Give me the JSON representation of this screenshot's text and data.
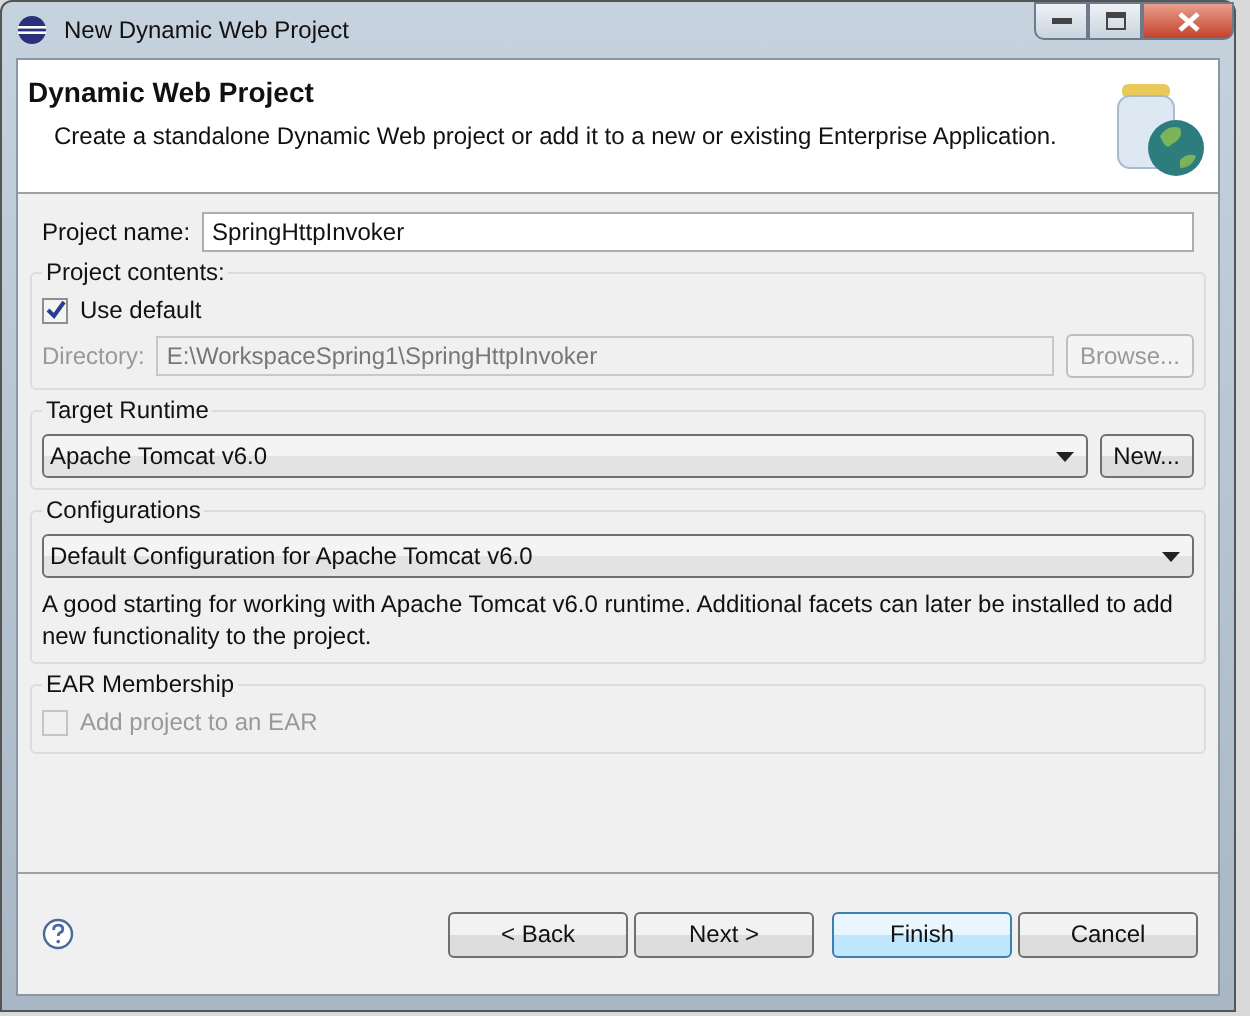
{
  "window": {
    "title": "New Dynamic Web Project"
  },
  "header": {
    "title": "Dynamic Web Project",
    "description": "Create a standalone Dynamic Web project or add it to a new or existing Enterprise Application."
  },
  "project_name": {
    "label": "Project name:",
    "value": "SpringHttpInvoker"
  },
  "project_contents": {
    "title": "Project contents:",
    "use_default": {
      "label": "Use default",
      "checked": true
    },
    "directory": {
      "label": "Directory:",
      "value": "E:\\WorkspaceSpring1\\SpringHttpInvoker",
      "disabled": true
    },
    "browse_button": {
      "label": "Browse...",
      "disabled": true
    }
  },
  "target_runtime": {
    "title": "Target Runtime",
    "value": "Apache Tomcat v6.0",
    "button": "New..."
  },
  "configurations": {
    "title": "Configurations",
    "value": "Default Configuration for Apache Tomcat v6.0",
    "description": "A good starting for working with Apache Tomcat v6.0 runtime. Additional facets can later be installed to add new functionality to the project."
  },
  "ear_membership": {
    "title": "EAR Membership",
    "add_to_ear": {
      "label": "Add project to an EAR",
      "checked": false,
      "disabled": true
    }
  },
  "buttons": [
    {
      "label": "< Back",
      "default": false
    },
    {
      "label": "Next >",
      "default": false
    },
    {
      "label": "Finish",
      "default": true
    },
    {
      "label": "Cancel",
      "default": false
    }
  ]
}
